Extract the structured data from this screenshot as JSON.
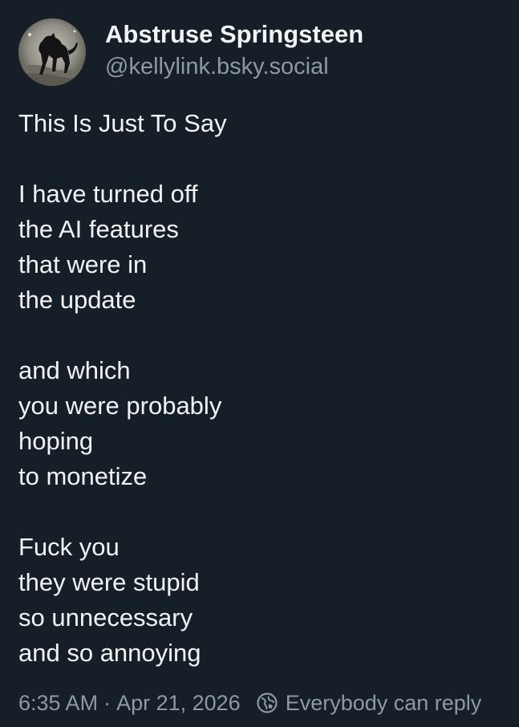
{
  "author": {
    "display_name": "Abstruse Springsteen",
    "handle": "@kellylink.bsky.social",
    "avatar_icon": "dog-silhouette-avatar"
  },
  "post": {
    "stanzas": [
      {
        "lines": [
          "This Is Just To Say"
        ]
      },
      {
        "lines": [
          "I have turned off",
          "the AI features",
          "that were in",
          "the update"
        ]
      },
      {
        "lines": [
          "and which",
          "you were probably",
          "hoping",
          "to monetize"
        ]
      },
      {
        "lines": [
          "Fuck you",
          "they were stupid",
          "so unnecessary",
          "and so annoying"
        ]
      }
    ]
  },
  "footer": {
    "time": "6:35 AM",
    "separator": "·",
    "date": "Apr 21, 2026",
    "reply_icon": "globe-icon",
    "reply_setting": "Everybody can reply"
  },
  "colors": {
    "background": "#161e27",
    "text": "#f1f3f5",
    "muted": "#8d99a6"
  }
}
